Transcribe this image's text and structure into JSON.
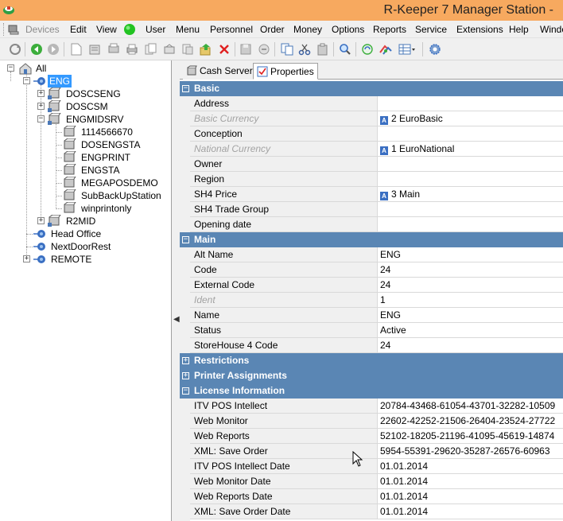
{
  "window": {
    "title": "R-Keeper 7 Manager Station - ",
    "app_icon": "r-keeper-icon"
  },
  "menu": {
    "items": [
      {
        "label": "Devices",
        "disabled": true
      },
      {
        "label": "Edit"
      },
      {
        "label": "View"
      },
      {
        "label": "User"
      },
      {
        "label": "Menu"
      },
      {
        "label": "Personnel"
      },
      {
        "label": "Order"
      },
      {
        "label": "Money"
      },
      {
        "label": "Options"
      },
      {
        "label": "Reports"
      },
      {
        "label": "Service"
      },
      {
        "label": "Extensions"
      },
      {
        "label": "Help"
      },
      {
        "label": "Windo"
      }
    ],
    "status_dot_color": "#22c322"
  },
  "toolbar": {
    "buttons": [
      "refresh-icon",
      "back-icon",
      "forward-icon",
      "new-icon",
      "open-icon",
      "print-preview-icon",
      "print-icon",
      "copy-doc-icon",
      "paste-doc-icon",
      "export-icon",
      "delete-icon",
      "save-icon",
      "cancel-icon",
      "copy-icon",
      "cut-icon",
      "paste-icon",
      "find-icon",
      "sync-icon",
      "link-icon",
      "grid-view-icon",
      "settings-icon"
    ]
  },
  "tree": {
    "nodes": [
      {
        "label": "All"
      },
      {
        "label": "ENG",
        "selected": true
      },
      {
        "label": "DOSCSENG"
      },
      {
        "label": "DOSCSM"
      },
      {
        "label": "ENGMIDSRV"
      },
      {
        "label": "1114566670"
      },
      {
        "label": "DOSENGSTA"
      },
      {
        "label": "ENGPRINT"
      },
      {
        "label": "ENGSTA"
      },
      {
        "label": "MEGAPOSDEMO"
      },
      {
        "label": "SubBackUpStation"
      },
      {
        "label": "winprintonly"
      },
      {
        "label": "R2MID"
      },
      {
        "label": "Head Office"
      },
      {
        "label": "NextDoorRest"
      },
      {
        "label": "REMOTE"
      }
    ]
  },
  "tabs": [
    {
      "label": "Cash Server",
      "active": false
    },
    {
      "label": "Properties",
      "active": true
    }
  ],
  "properties": {
    "basic": {
      "title": "Basic",
      "rows": [
        {
          "name": "Address",
          "value": ""
        },
        {
          "name": "Basic Currency",
          "value": "2 EuroBasic",
          "italic": true,
          "ref": true
        },
        {
          "name": "Conception",
          "value": ""
        },
        {
          "name": "National Currency",
          "value": "1 EuroNational",
          "italic": true,
          "ref": true
        },
        {
          "name": "Owner",
          "value": ""
        },
        {
          "name": "Region",
          "value": ""
        },
        {
          "name": "SH4 Price",
          "value": "3 Main",
          "ref": true
        },
        {
          "name": "SH4 Trade Group",
          "value": ""
        },
        {
          "name": "Opening date",
          "value": ""
        }
      ]
    },
    "main": {
      "title": "Main",
      "rows": [
        {
          "name": "Alt Name",
          "value": "ENG"
        },
        {
          "name": "Code",
          "value": "24"
        },
        {
          "name": "External Code",
          "value": "24"
        },
        {
          "name": "Ident",
          "value": "1",
          "italic": true
        },
        {
          "name": "Name",
          "value": "ENG"
        },
        {
          "name": "Status",
          "value": "Active"
        },
        {
          "name": "StoreHouse 4 Code",
          "value": "24"
        }
      ]
    },
    "restrictions": {
      "title": "Restrictions"
    },
    "printer_assignments": {
      "title": "Printer Assignments"
    },
    "license": {
      "title": "License Information",
      "rows": [
        {
          "name": "ITV POS Intellect",
          "value": "20784-43468-61054-43701-32282-10509"
        },
        {
          "name": "Web Monitor",
          "value": "22602-42252-21506-26404-23524-27722"
        },
        {
          "name": "Web Reports",
          "value": "52102-18205-21196-41095-45619-14874"
        },
        {
          "name": "XML: Save Order",
          "value": "5954-55391-29620-35287-26576-60963"
        },
        {
          "name": "ITV POS Intellect Date",
          "value": "01.01.2014"
        },
        {
          "name": "Web Monitor Date",
          "value": "01.01.2014"
        },
        {
          "name": "Web Reports Date",
          "value": "01.01.2014"
        },
        {
          "name": "XML: Save Order Date",
          "value": "01.01.2014"
        }
      ]
    }
  },
  "colors": {
    "title_bar": "#f7a95f",
    "category_header": "#5a86b4",
    "selection": "#3399ff"
  }
}
